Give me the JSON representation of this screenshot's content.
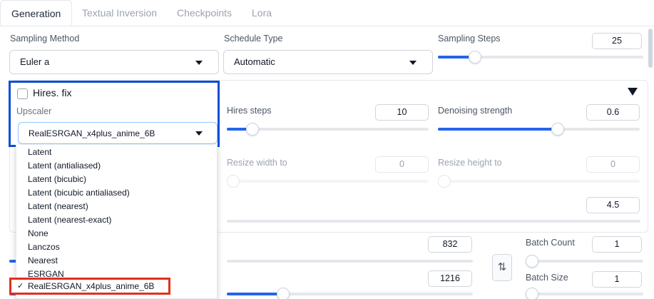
{
  "tabs": [
    {
      "label": "Generation"
    },
    {
      "label": "Textual Inversion"
    },
    {
      "label": "Checkpoints"
    },
    {
      "label": "Lora"
    }
  ],
  "sampling_method": {
    "label": "Sampling Method",
    "value": "Euler a"
  },
  "schedule_type": {
    "label": "Schedule Type",
    "value": "Automatic"
  },
  "sampling_steps": {
    "label": "Sampling Steps",
    "value": "25",
    "fraction": 0.16
  },
  "hires": {
    "checkbox_label": "Hires. fix",
    "checked": false,
    "upscaler_label": "Upscaler",
    "upscaler_value": "RealESRGAN_x4plus_anime_6B",
    "hires_steps_label": "Hires steps",
    "hires_steps_value": "10",
    "hires_steps_fraction": 0.1,
    "denoising_label": "Denoising strength",
    "denoising_value": "0.6",
    "denoising_fraction": 0.6,
    "upscale_by_value": "4.5",
    "resize_width_label": "Resize width to",
    "resize_width_value": "0",
    "resize_height_label": "Resize height to",
    "resize_height_value": "0"
  },
  "upscaler_options": [
    "Latent",
    "Latent (antialiased)",
    "Latent (bicubic)",
    "Latent (bicubic antialiased)",
    "Latent (nearest)",
    "Latent (nearest-exact)",
    "None",
    "Lanczos",
    "Nearest",
    "ESRGAN",
    "RealESRGAN_x4plus_anime_6B"
  ],
  "selected_option_check": "✓",
  "width_value": "832",
  "height_value": "1216",
  "swap_icon": "⇅",
  "batch_count": {
    "label": "Batch Count",
    "value": "1"
  },
  "batch_size": {
    "label": "Batch Size",
    "value": "1"
  },
  "colors": {
    "accent": "#2563eb",
    "highlight_blue": "#0b4fd6",
    "highlight_red": "#e0301e"
  }
}
